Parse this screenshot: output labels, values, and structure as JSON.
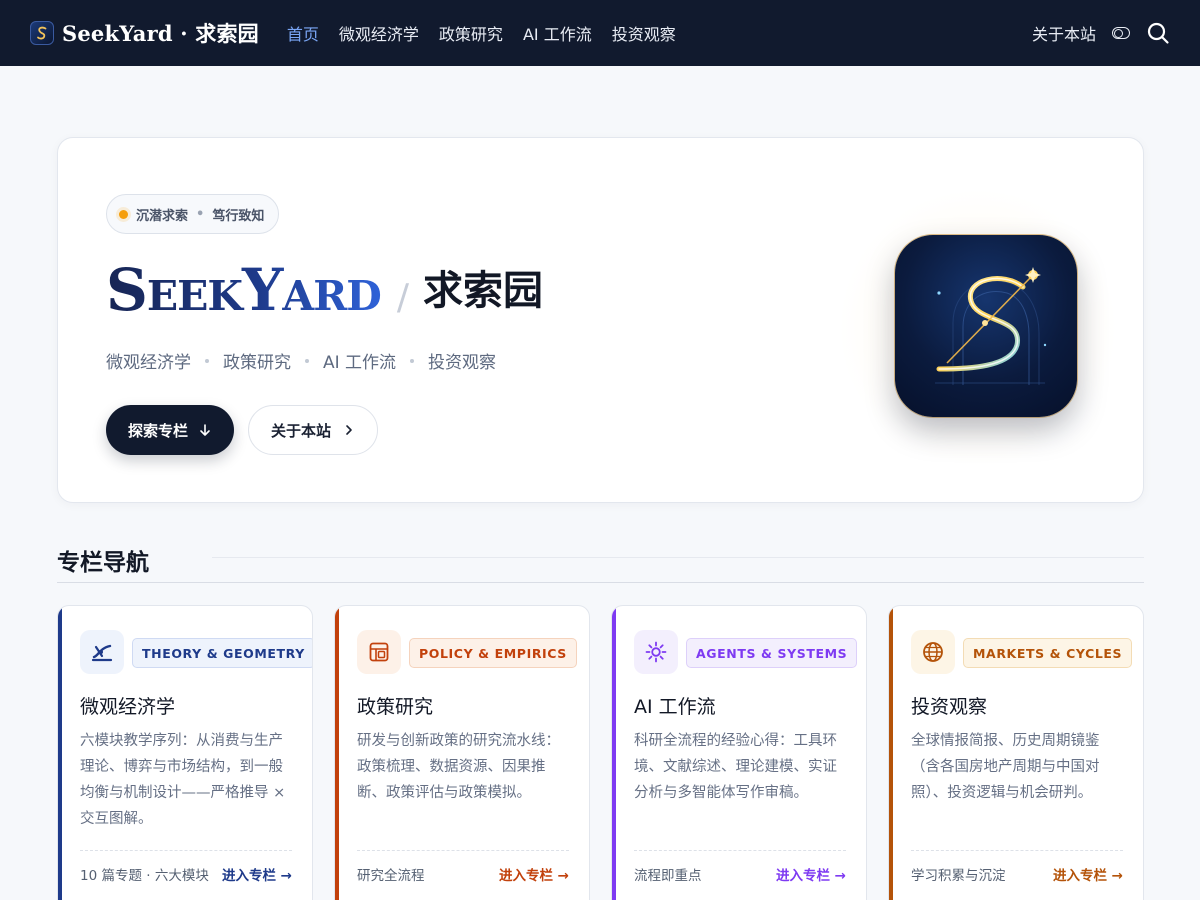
{
  "nav": {
    "brand": "SeekYard · 求索园",
    "links": [
      "首页",
      "微观经济学",
      "政策研究",
      "AI 工作流",
      "投资观察"
    ],
    "about": "关于本站"
  },
  "hero": {
    "motto_a": "沉潜求索",
    "motto_sep": "•",
    "motto_b": "笃行致知",
    "title_en": "SeekYard",
    "title_slash": "/",
    "title_cn": "求索园",
    "topics": [
      "微观经济学",
      "政策研究",
      "AI 工作流",
      "投资观察"
    ],
    "btn_primary": "探索专栏",
    "btn_secondary": "关于本站"
  },
  "section": {
    "title": "专栏导航"
  },
  "cards": [
    {
      "tag": "THEORY & GEOMETRY",
      "title": "微观经济学",
      "desc": "六模块教学序列：从消费与生产理论、博弈与市场结构，到一般均衡与机制设计——严格推导 × 交互图解。",
      "meta": "10 篇专题 · 六大模块",
      "link": "进入专栏 →",
      "icon": "chart-curve-icon",
      "accent": "#1e3a8a"
    },
    {
      "tag": "POLICY & EMPIRICS",
      "title": "政策研究",
      "desc": "研发与创新政策的研究流水线：政策梳理、数据资源、因果推断、政策评估与政策模拟。",
      "meta": "研究全流程",
      "link": "进入专栏 →",
      "icon": "policy-panel-icon",
      "accent": "#c2410c"
    },
    {
      "tag": "AGENTS & SYSTEMS",
      "title": "AI 工作流",
      "desc": "科研全流程的经验心得：工具环境、文献综述、理论建模、实证分析与多智能体写作审稿。",
      "meta": "流程即重点",
      "link": "进入专栏 →",
      "icon": "sun-gear-icon",
      "accent": "#7e3af2"
    },
    {
      "tag": "MARKETS & CYCLES",
      "title": "投资观察",
      "desc": "全球情报简报、历史周期镜鉴（含各国房地产周期与中国对照）、投资逻辑与机会研判。",
      "meta": "学习积累与沉淀",
      "link": "进入专栏 →",
      "icon": "globe-icon",
      "accent": "#b45309"
    }
  ]
}
